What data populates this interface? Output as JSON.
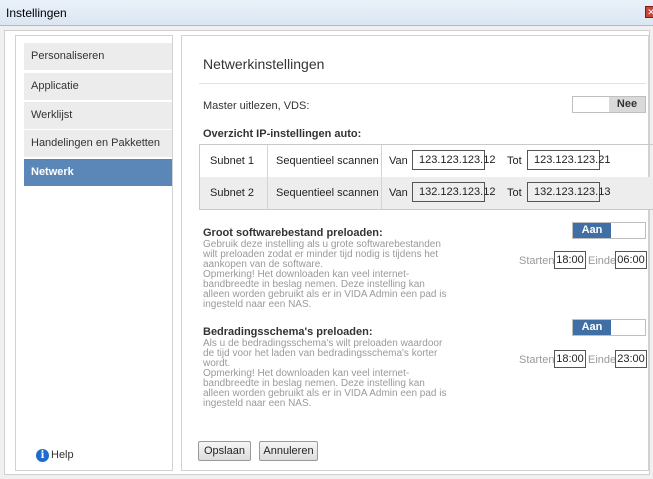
{
  "window": {
    "title": "Instellingen"
  },
  "sidebar": {
    "items": [
      {
        "label": "Personaliseren",
        "active": false
      },
      {
        "label": "Applicatie",
        "active": false
      },
      {
        "label": "Werklijst",
        "active": false
      },
      {
        "label": "Handelingen en Pakketten",
        "active": false
      },
      {
        "label": "Netwerk",
        "active": true
      }
    ],
    "help_label": "Help"
  },
  "main": {
    "heading": "Netwerkinstellingen",
    "master": {
      "label": "Master uitlezen, VDS:",
      "toggle": "Nee"
    },
    "overview_title": "Overzicht IP-instellingen auto:",
    "subnets": [
      {
        "name": "Subnet 1",
        "mode": "Sequentieel scannen",
        "from_label": "Van",
        "from": "123.123.123.12",
        "to_label": "Tot",
        "to": "123.123.123.21"
      },
      {
        "name": "Subnet 2",
        "mode": "Sequentieel scannen",
        "from_label": "Van",
        "from": "132.123.123.12",
        "to_label": "Tot",
        "to": "132.123.123.13"
      }
    ],
    "preload_software": {
      "title": "Groot softwarebestand preloaden:",
      "toggle": "Aan",
      "description": "Gebruik deze instelling als u grote softwarebestanden wilt preloaden zodat er minder tijd nodig is tijdens het aankopen van de software.\nOpmerking! Het downloaden kan veel internet-bandbreedte in beslag nemen. Deze instelling kan alleen worden gebruikt als er in VIDA Admin een pad is ingesteld naar een NAS.",
      "start_label": "Starten",
      "start": "18:00",
      "end_label": "Einde",
      "end": "06:00"
    },
    "preload_wiring": {
      "title": "Bedradingsschema's preloaden:",
      "toggle": "Aan",
      "description": "Als u de bedradingsschema's wilt preloaden waardoor de tijd voor het laden van bedradingsschema's korter wordt.\nOpmerking! Het downloaden kan veel internet-bandbreedte in beslag nemen. Deze instelling kan alleen worden gebruikt als er in VIDA Admin een pad is ingesteld naar een NAS.",
      "start_label": "Starten",
      "start": "18:00",
      "end_label": "Einde",
      "end": "23:00"
    },
    "buttons": {
      "save": "Opslaan",
      "cancel": "Annuleren"
    }
  },
  "colors": {
    "accent": "#3f6fa5",
    "sidebar_active": "#5b87b8"
  }
}
